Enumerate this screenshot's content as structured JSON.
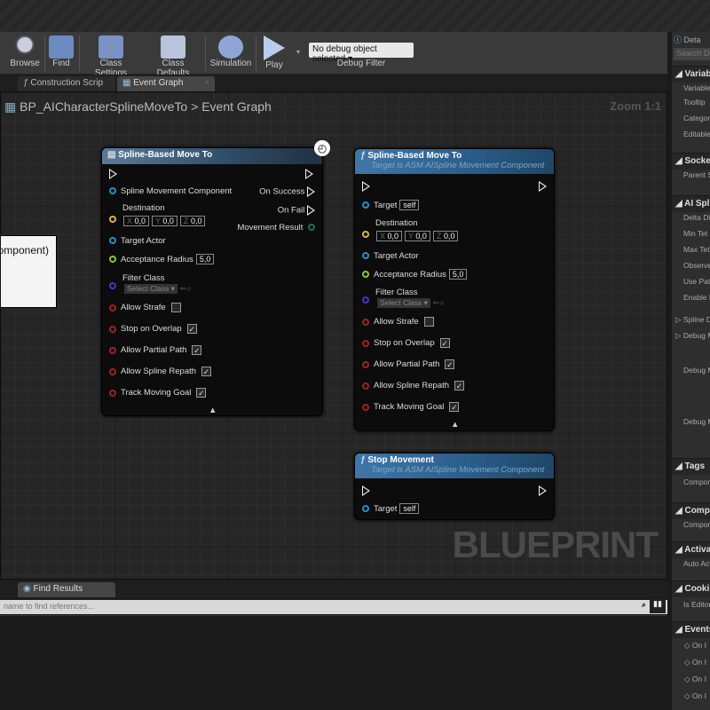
{
  "toolbar": {
    "buttons": [
      "Browse",
      "Find",
      "Class Settings",
      "Class Defaults",
      "Simulation",
      "Play"
    ],
    "debug_select": "No debug object selected",
    "debug_label": "Debug Filter"
  },
  "tabs": [
    "Construction Scrip",
    "Event Graph"
  ],
  "breadcrumb": {
    "blueprint": "BP_AICharacterSplineMoveTo",
    "separator": ">",
    "graph": "Event Graph"
  },
  "zoom": "Zoom 1:1",
  "watermark": "BLUEPRINT",
  "partial_node_text": "omponent)",
  "pin_colors": {
    "object": "#2a8fc7",
    "vector": "#e0b53a",
    "float": "#8ac63c",
    "class": "#5a2bd0",
    "bool": "#a52020"
  },
  "node1": {
    "title": "Spline-Based Move To",
    "inputs": {
      "smc": "Spline Movement Component",
      "dest": "Destination",
      "x": "X",
      "y": "Y",
      "z": "Z",
      "xv": "0,0",
      "yv": "0,0",
      "zv": "0,0",
      "target_actor": "Target Actor",
      "acc": "Acceptance Radius",
      "acc_v": "5,0",
      "filter": "Filter Class",
      "select": "Select Class",
      "strafe": "Allow Strafe",
      "stop": "Stop on Overlap",
      "partial": "Allow Partial Path",
      "repath": "Allow Spline Repath",
      "track": "Track Moving Goal"
    },
    "outputs": {
      "success": "On Success",
      "fail": "On Fail",
      "result": "Movement Result"
    },
    "checks": {
      "strafe": false,
      "stop": true,
      "partial": true,
      "repath": true,
      "track": true
    }
  },
  "node2": {
    "title": "Spline-Based Move To",
    "subtitle": "Target is ASM AISpline Movement Component",
    "target": "Target",
    "self": "self",
    "dest": "Destination",
    "x": "X",
    "y": "Y",
    "z": "Z",
    "xv": "0,0",
    "yv": "0,0",
    "zv": "0,0",
    "target_actor": "Target Actor",
    "acc": "Acceptance Radius",
    "acc_v": "5,0",
    "filter": "Filter Class",
    "select": "Select Class",
    "strafe": "Allow Strafe",
    "stop": "Stop on Overlap",
    "partial": "Allow Partial Path",
    "repath": "Allow Spline Repath",
    "track": "Track Moving Goal"
  },
  "node3": {
    "title": "Stop Movement",
    "subtitle": "Target is ASM AISpline Movement Component",
    "target": "Target",
    "self": "self"
  },
  "find": {
    "tab": "Find Results",
    "placeholder": "name to find references..."
  },
  "details": {
    "tab": "Deta",
    "search": "Search D",
    "sections": [
      {
        "title": "Variable",
        "items": [
          "Variable",
          "Tooltip",
          "Categor",
          "Editable"
        ]
      },
      {
        "title": "Socket",
        "items": [
          "Parent S"
        ]
      },
      {
        "title": "AI Splin",
        "items": [
          "Delta Di",
          "Min Tet",
          "Max Tet",
          "Observe",
          "Use Pat",
          "Enable D"
        ]
      },
      {
        "title": "",
        "items": [
          "Spline D",
          "Debug M",
          "Debug M",
          "Debug M"
        ]
      },
      {
        "title": "Tags",
        "items": [
          "Compon"
        ]
      },
      {
        "title": "Compor",
        "items": [
          "Compon"
        ]
      },
      {
        "title": "Activat",
        "items": [
          "Auto Act"
        ]
      },
      {
        "title": "Cooking",
        "items": [
          "Is Editor"
        ]
      },
      {
        "title": "Events",
        "items": [
          "On I",
          "On I",
          "On I",
          "On I"
        ]
      }
    ]
  }
}
